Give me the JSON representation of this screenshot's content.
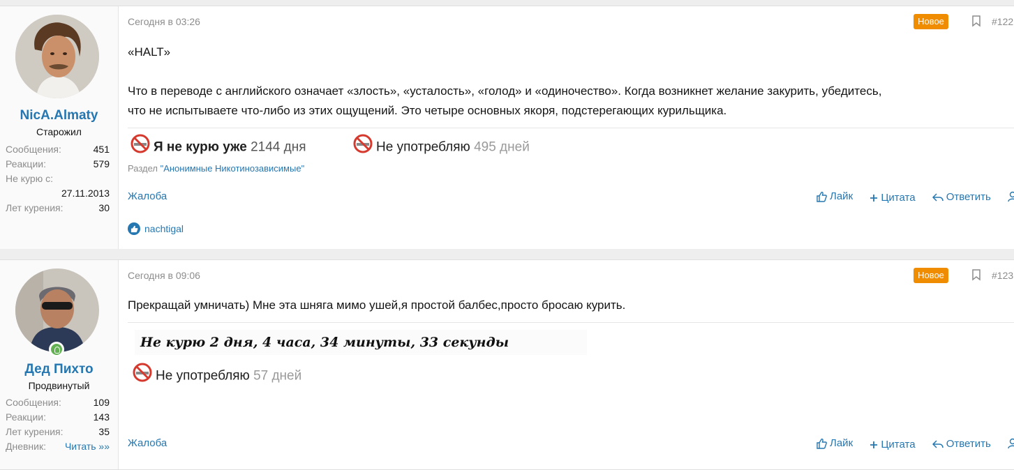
{
  "posts": [
    {
      "user": {
        "name": "NicA.Almaty",
        "title": "Старожил",
        "stats": [
          {
            "k": "Сообщения:",
            "v": "451"
          },
          {
            "k": "Реакции:",
            "v": "579"
          },
          {
            "k": "Не курю с:",
            "v": ""
          },
          {
            "k": "",
            "v": "27.11.2013"
          },
          {
            "k": "Лет курения:",
            "v": "30"
          }
        ]
      },
      "date": "Сегодня в 03:26",
      "badge": "Новое",
      "number": "#122",
      "text": [
        "«HALT»",
        "Что в переводе с английского означает «злость», «усталость», «голод» и «одиночество». Когда возникнет желание закурить, убедитесь,",
        "что не испытываете что-либо из этих ощущений. Это четыре основных якоря, подстерегающих курильщика."
      ],
      "sig1_prefix": "Я не курю уже",
      "sig1_num": "2144 дня",
      "sig2_prefix": "Не употребляю",
      "sig2_num": "495 дней",
      "section_label": "Раздел",
      "section_link": "\"Анонимные Никотинозависимые\"",
      "report": "Жалоба",
      "actions": {
        "like": "Лайк",
        "quote": "Цитата",
        "reply": "Ответить"
      },
      "liked_by": "nachtigal"
    },
    {
      "user": {
        "name": "Дед Пихто",
        "title": "Продвинутый",
        "stats": [
          {
            "k": "Сообщения:",
            "v": "109"
          },
          {
            "k": "Реакции:",
            "v": "143"
          },
          {
            "k": "Лет курения:",
            "v": "35"
          },
          {
            "k": "Дневник:",
            "v": "Читать »»"
          }
        ]
      },
      "date": "Сегодня в 09:06",
      "badge": "Новое",
      "number": "#123",
      "text": "Прекращай умничать) Мне эта шняга мимо ушей,я простой балбес,просто бросаю курить.",
      "sig_hand": "Не курю  2 дня, 4 часа, 34 минуты, 33 секунды",
      "sig2_prefix": "Не употребляю",
      "sig2_num": "57 дней",
      "report": "Жалоба",
      "actions": {
        "like": "Лайк",
        "quote": "Цитата",
        "reply": "Ответить"
      }
    }
  ],
  "colors": {
    "link": "#2577b1",
    "badge": "#f08c00",
    "online": "#63b153"
  }
}
